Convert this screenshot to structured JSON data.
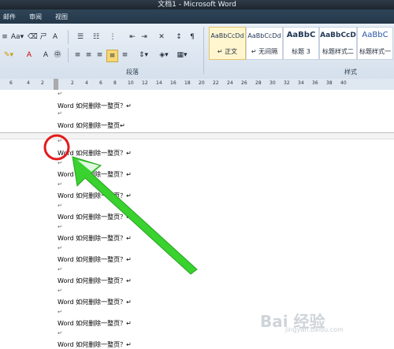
{
  "window": {
    "title": "文档1 - Microsoft Word"
  },
  "tabs": [
    "邮件",
    "审阅",
    "视图"
  ],
  "toolbar": {
    "font_size_label": "Aa▾",
    "bullets_label": "☰",
    "a_text": "A",
    "paragraph_group": "段落",
    "styles_group": "样式"
  },
  "styles": [
    {
      "sample": "AaBbCcDd",
      "label": "↵ 正文"
    },
    {
      "sample": "AaBbCcDd",
      "label": "↵ 无间隔"
    },
    {
      "sample": "AaBbC",
      "label": "标题 3"
    },
    {
      "sample": "AaBbCcD",
      "label": "标题样式二"
    },
    {
      "sample": "AaBbC",
      "label": "标题样式一"
    }
  ],
  "ruler": [
    "6",
    "4",
    "2",
    "2",
    "4",
    "6",
    "8",
    "10",
    "12",
    "14",
    "16",
    "18",
    "20",
    "22",
    "24",
    "26",
    "28",
    "30",
    "32",
    "34",
    "36",
    "38",
    "40"
  ],
  "document": {
    "lines": [
      "Word 如何删除一整页？↵",
      "Word 如何删除一整页↵",
      "Word 如何删除一整页？↵",
      "Word 如何删除一整页？↵",
      "Word 如何删除一整页？↵",
      "Word 如何删除一整页？↵",
      "Word 如何删除一整页？↵",
      "Word 如何删除一整页？↵",
      "Word 如何删除一整页？↵",
      "Word 如何删除一整页？↵",
      "Word 如何删除一整页？↵",
      "Word 如何删除一整页？↵"
    ],
    "para_mark": "↵"
  },
  "watermark": "Bai 经验",
  "watermark_sub": "jingyan.baidu.com"
}
